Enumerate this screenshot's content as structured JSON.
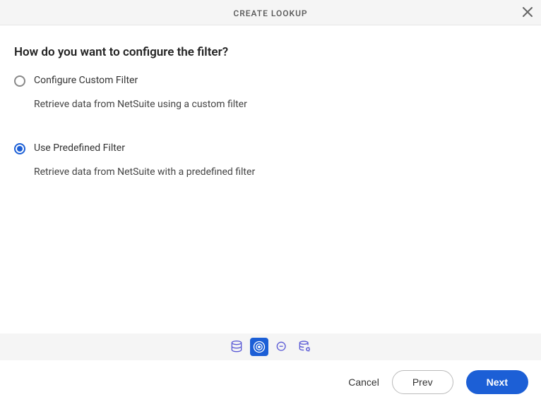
{
  "header": {
    "title": "CREATE LOOKUP"
  },
  "question": "How do you want to configure the filter?",
  "options": [
    {
      "label": "Configure Custom Filter",
      "desc": "Retrieve data from NetSuite using a custom filter",
      "selected": false
    },
    {
      "label": "Use Predefined Filter",
      "desc": "Retrieve data from NetSuite with a predefined filter",
      "selected": true
    }
  ],
  "footer": {
    "cancel": "Cancel",
    "prev": "Prev",
    "next": "Next"
  }
}
